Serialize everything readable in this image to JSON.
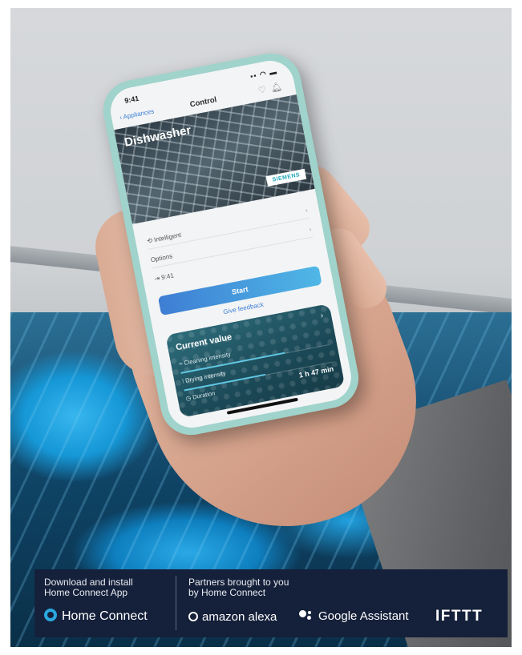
{
  "phone": {
    "status": {
      "time": "9:41",
      "signal": "▪▪ ◠ ▬"
    },
    "nav": {
      "back_label": "‹ Appliances",
      "title": "Control",
      "icons": [
        "heart-icon",
        "bell-icon"
      ]
    },
    "hero": {
      "appliance_name": "Dishwasher",
      "brand": "SIEMENS"
    },
    "rows": [
      {
        "label": "Intelligent",
        "icon": "program-icon"
      },
      {
        "label": "Options"
      },
      {
        "label": "9:41",
        "icon": "end-time-icon"
      }
    ],
    "start_label": "Start",
    "feedback_label": "Give feedback",
    "card": {
      "title": "Current value",
      "items": [
        {
          "label": "Cleaning intensity",
          "icon": "spray-icon",
          "level": 0.7
        },
        {
          "label": "Drying intensity",
          "icon": "steam-icon",
          "level": 0.55
        },
        {
          "label": "Duration",
          "icon": "clock-icon",
          "value": "1 h 47 min"
        }
      ]
    }
  },
  "banner": {
    "install_text_1": "Download and install",
    "install_text_2": "Home Connect App",
    "partners_text_1": "Partners brought to you",
    "partners_text_2": "by Home Connect",
    "home_connect": "Home Connect",
    "alexa": "amazon alexa",
    "google": "Google Assistant",
    "ifttt": "IFTTT"
  },
  "colors": {
    "banner_bg": "#15203a",
    "accent_blue": "#2aa8e0",
    "phone_case": "#9fd3cb"
  }
}
